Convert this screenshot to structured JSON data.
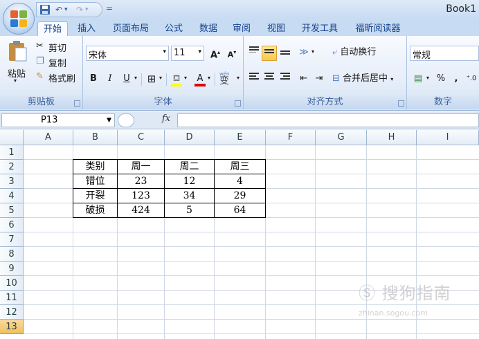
{
  "window": {
    "title": "Book1"
  },
  "quick_access": {
    "save_icon": "save-icon",
    "undo_icon": "undo-icon",
    "redo_icon": "redo-icon",
    "menu_glyph": "="
  },
  "tabs": [
    {
      "label": "开始",
      "active": true
    },
    {
      "label": "插入"
    },
    {
      "label": "页面布局"
    },
    {
      "label": "公式"
    },
    {
      "label": "数据"
    },
    {
      "label": "审阅"
    },
    {
      "label": "视图"
    },
    {
      "label": "开发工具"
    },
    {
      "label": "福昕阅读器"
    }
  ],
  "ribbon": {
    "clipboard": {
      "paste": "粘贴",
      "cut": "剪切",
      "copy": "复制",
      "format_painter": "格式刷",
      "label": "剪贴板"
    },
    "font": {
      "name": "宋体",
      "size": "11",
      "bold": "B",
      "italic": "I",
      "underline": "U",
      "grow": "A",
      "shrink": "A",
      "font_color": "A",
      "phonetic": "wén",
      "phonetic_char": "变",
      "label": "字体"
    },
    "alignment": {
      "wrap": "自动换行",
      "merge": "合并后居中",
      "label": "对齐方式"
    },
    "number": {
      "format": "常规",
      "percent": "%",
      "comma": ",",
      "label": "数字"
    }
  },
  "formula_bar": {
    "name_box": "P13",
    "fx": "fx",
    "value": ""
  },
  "grid": {
    "columns": [
      "A",
      "B",
      "C",
      "D",
      "E",
      "F",
      "G",
      "H",
      "I"
    ],
    "rows": [
      "1",
      "2",
      "3",
      "4",
      "5",
      "6",
      "7",
      "8",
      "9",
      "10",
      "11",
      "12",
      "13"
    ],
    "selected_row": "13"
  },
  "table": {
    "headers": [
      "类别",
      "周一",
      "周二",
      "周三"
    ],
    "rows": [
      [
        "错位",
        "23",
        "12",
        "4"
      ],
      [
        "开裂",
        "123",
        "34",
        "29"
      ],
      [
        "破损",
        "424",
        "5",
        "64"
      ]
    ]
  },
  "watermark": {
    "text": "搜狗指南",
    "url": "zhinan.sogou.com"
  },
  "colors": {
    "ribbon_bg": "#dfe8f5",
    "tab_text": "#15428b",
    "selected_header": "#f1c15f"
  }
}
